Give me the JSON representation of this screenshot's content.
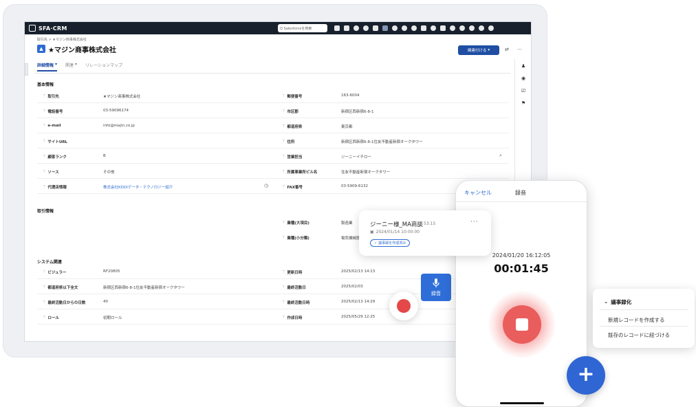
{
  "app": {
    "brand": "SFA·CRM"
  },
  "search": {
    "placeholder": "Q Salesforceを検索"
  },
  "breadcrumb": "取引先 > ★マジン商事株式会社",
  "account": {
    "title": "★マジン商事株式会社",
    "follow_label": "関連付ける",
    "follow_caret": "▾"
  },
  "tabs": [
    {
      "label": "詳細情報",
      "caret": "▾"
    },
    {
      "label": "関連",
      "caret": "▾"
    },
    {
      "label": "リレーションマップ",
      "caret": ""
    }
  ],
  "sections": {
    "basic": "基本情報",
    "deal": "取引情報",
    "system": "システム関連"
  },
  "basic_rows": [
    {
      "left_label": "取引先",
      "left_value": "★マジン商事株式会社",
      "right_label": "郵便番号",
      "right_value": "163-6004"
    },
    {
      "left_label": "電話番号",
      "left_value": "03-59096174",
      "right_label": "市区郡",
      "right_value": "新宿区西新宿6-8-1"
    },
    {
      "left_label": "e-mail",
      "left_value": "info@majin.co.jp",
      "right_label": "都道府県",
      "right_value": "東京都"
    },
    {
      "left_label": "サイトURL",
      "left_value": "",
      "right_label": "住所",
      "right_value": "新宿区西新宿6-8-1住友不動産新宿オークタワー"
    },
    {
      "left_label": "顧客ランク",
      "left_value": "B",
      "right_label": "営業担当",
      "right_value": "ジーニーイチロー"
    },
    {
      "left_label": "ソース",
      "left_value": "その他",
      "right_label": "所属事業所ビル名",
      "right_value": "住友不動産新宿オークタワー"
    },
    {
      "left_label": "代理店情報",
      "left_value": "株式会社KDDIデータ・テクノロジー紹介",
      "right_label": "FAX番号",
      "right_value": "03-5909-6132"
    }
  ],
  "deal_rows": [
    {
      "label": "業種(大項目)",
      "value": "製造業"
    },
    {
      "label": "業種(小分類)",
      "value": "電気機械器具製造業"
    }
  ],
  "system_rows": [
    {
      "left_label": "ビジュラー",
      "left_value": "RF20805",
      "right_label": "更新日時",
      "right_value": "2025/02/13 14:13"
    },
    {
      "left_label": "都道府県以下全文",
      "left_value": "新宿区西新宿6-8-1住友不動産新宿オークタワー",
      "right_label": "最終活動日",
      "right_value": "2025/02/03"
    },
    {
      "left_label": "最終活動日からの日数",
      "left_value": "40",
      "right_label": "最終活動日時",
      "right_value": "2025/02/13 14:29"
    },
    {
      "left_label": "ロール",
      "left_value": "初期ロール",
      "right_label": "作成日時",
      "right_value": "2025/05/29 12:25"
    }
  ],
  "mic_button": {
    "label": "録音"
  },
  "phone": {
    "cancel_label": "キャンセル",
    "title": "録音",
    "date": "2024/01/20 16:12:05",
    "timer": "00:01:45"
  },
  "meeting_card": {
    "title": "ジーニー様_MA商談",
    "duration": "53:15",
    "date": "2024/01/14 10:00:00",
    "badge": "議事録を作成済み"
  },
  "minutes_menu": {
    "title": "議事録化",
    "option_new": "新規レコードを作成する",
    "option_link": "既存のレコードに紐づける"
  },
  "colors": {
    "brand_blue": "#1f4ea3",
    "record_red": "#ea5d5d",
    "fab_blue": "#2f66d4"
  }
}
